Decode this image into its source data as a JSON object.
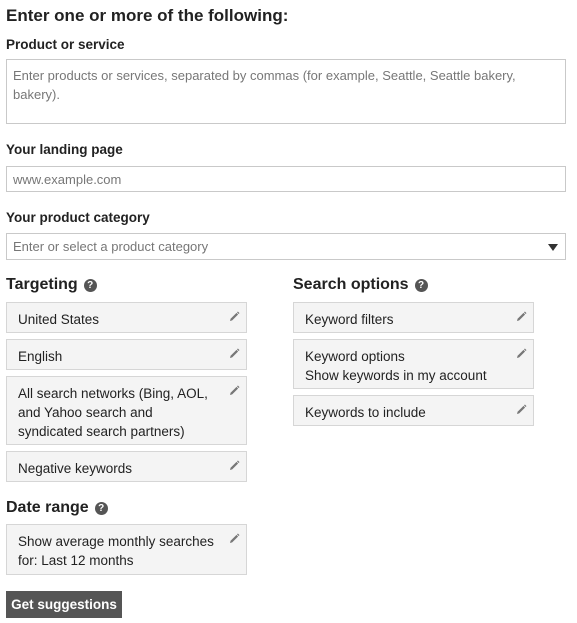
{
  "heading": "Enter one or more of the following:",
  "product": {
    "label": "Product or service",
    "placeholder": "Enter products or services, separated by commas (for example, Seattle, Seattle bakery, bakery)."
  },
  "landing": {
    "label": "Your landing page",
    "placeholder": "www.example.com"
  },
  "category": {
    "label": "Your product category",
    "placeholder": "Enter or select a product category"
  },
  "targeting": {
    "title": "Targeting",
    "items": [
      {
        "text": "United States"
      },
      {
        "text": "English"
      },
      {
        "text": "All search networks (Bing, AOL, and Yahoo search and syndicated search partners)"
      },
      {
        "text": "Negative keywords"
      }
    ]
  },
  "search_options": {
    "title": "Search options",
    "items": [
      {
        "text": "Keyword filters"
      },
      {
        "text": "Keyword options",
        "subtext": "Show keywords in my account"
      },
      {
        "text": "Keywords to include"
      }
    ]
  },
  "date_range": {
    "title": "Date range",
    "text": "Show average monthly searches for: Last 12 months"
  },
  "help_glyph": "?",
  "submit_label": "Get suggestions"
}
